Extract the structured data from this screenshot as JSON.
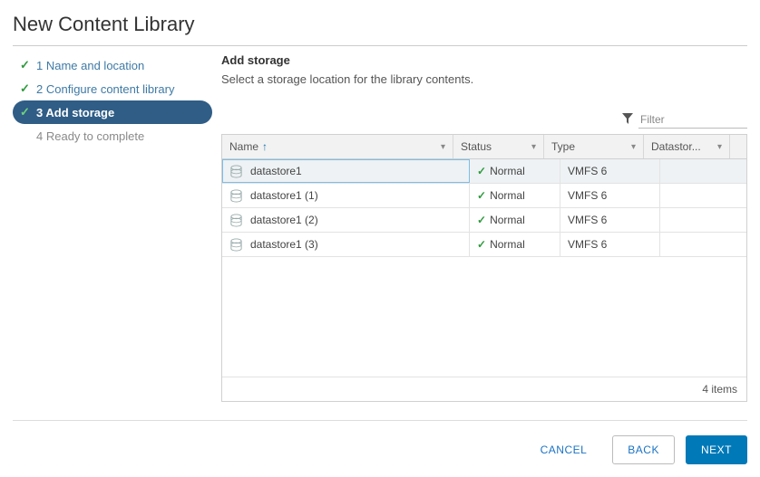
{
  "title": "New Content Library",
  "steps": [
    {
      "label": "1 Name and location",
      "state": "done"
    },
    {
      "label": "2 Configure content library",
      "state": "done"
    },
    {
      "label": "3 Add storage",
      "state": "active"
    },
    {
      "label": "4 Ready to complete",
      "state": "disabled"
    }
  ],
  "panel": {
    "heading": "Add storage",
    "subheading": "Select a storage location for the library contents."
  },
  "filter": {
    "placeholder": "Filter"
  },
  "columns": {
    "name": "Name",
    "status": "Status",
    "type": "Type",
    "datastore": "Datastor..."
  },
  "sort": {
    "column": "name",
    "direction": "asc"
  },
  "rows": [
    {
      "name": "datastore1",
      "status": "Normal",
      "type": "VMFS 6",
      "selected": true
    },
    {
      "name": "datastore1 (1)",
      "status": "Normal",
      "type": "VMFS 6",
      "selected": false
    },
    {
      "name": "datastore1 (2)",
      "status": "Normal",
      "type": "VMFS 6",
      "selected": false
    },
    {
      "name": "datastore1 (3)",
      "status": "Normal",
      "type": "VMFS 6",
      "selected": false
    }
  ],
  "footer": {
    "count_label": "4 items"
  },
  "buttons": {
    "cancel": "CANCEL",
    "back": "BACK",
    "next": "NEXT"
  }
}
